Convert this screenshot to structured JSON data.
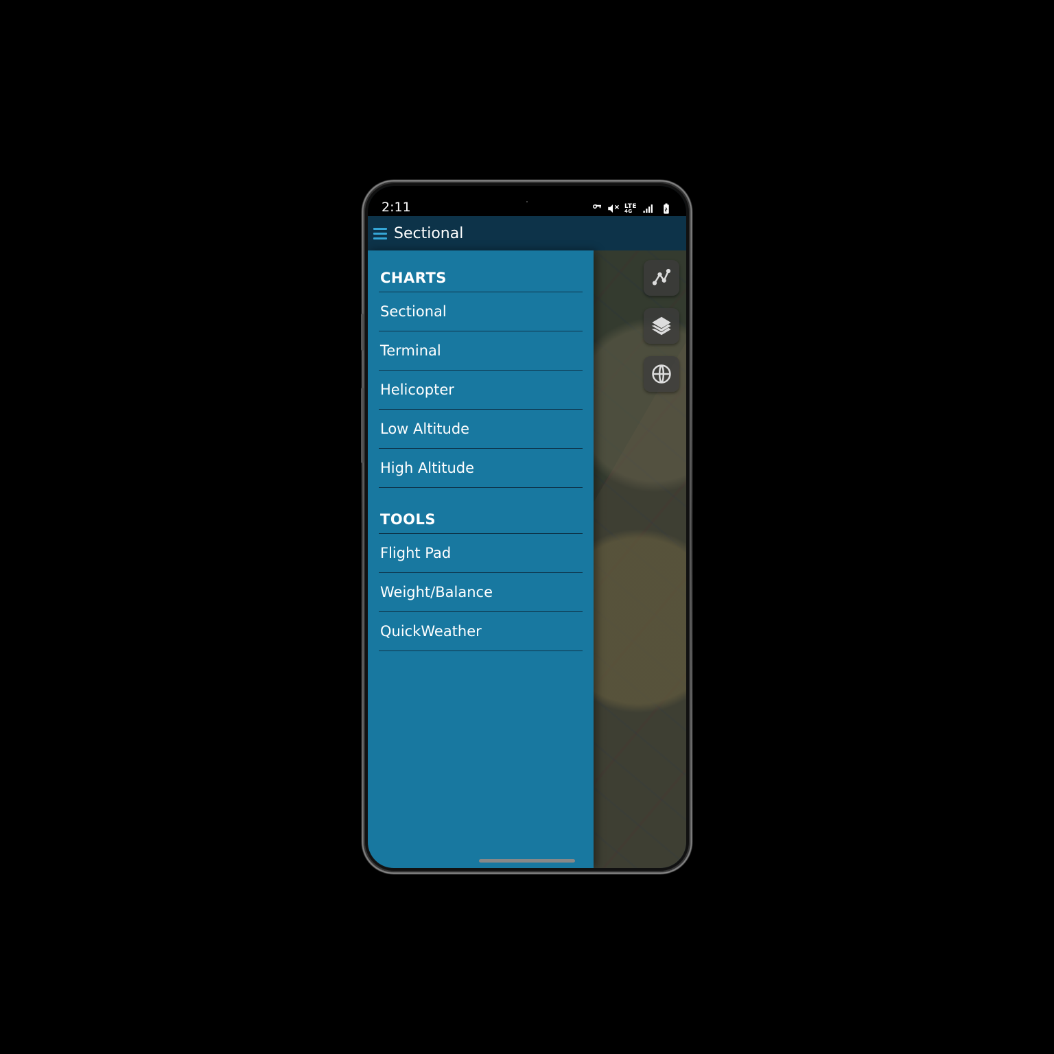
{
  "statusbar": {
    "time": "2:11"
  },
  "titlebar": {
    "title": "Sectional"
  },
  "drawer": {
    "charts_header": "CHARTS",
    "charts": [
      "Sectional",
      "Terminal",
      "Helicopter",
      "Low Altitude",
      "High Altitude"
    ],
    "tools_header": "TOOLS",
    "tools": [
      "Flight Pad",
      "Weight/Balance",
      "QuickWeather"
    ]
  },
  "fabs": [
    "route",
    "layers",
    "globe"
  ]
}
